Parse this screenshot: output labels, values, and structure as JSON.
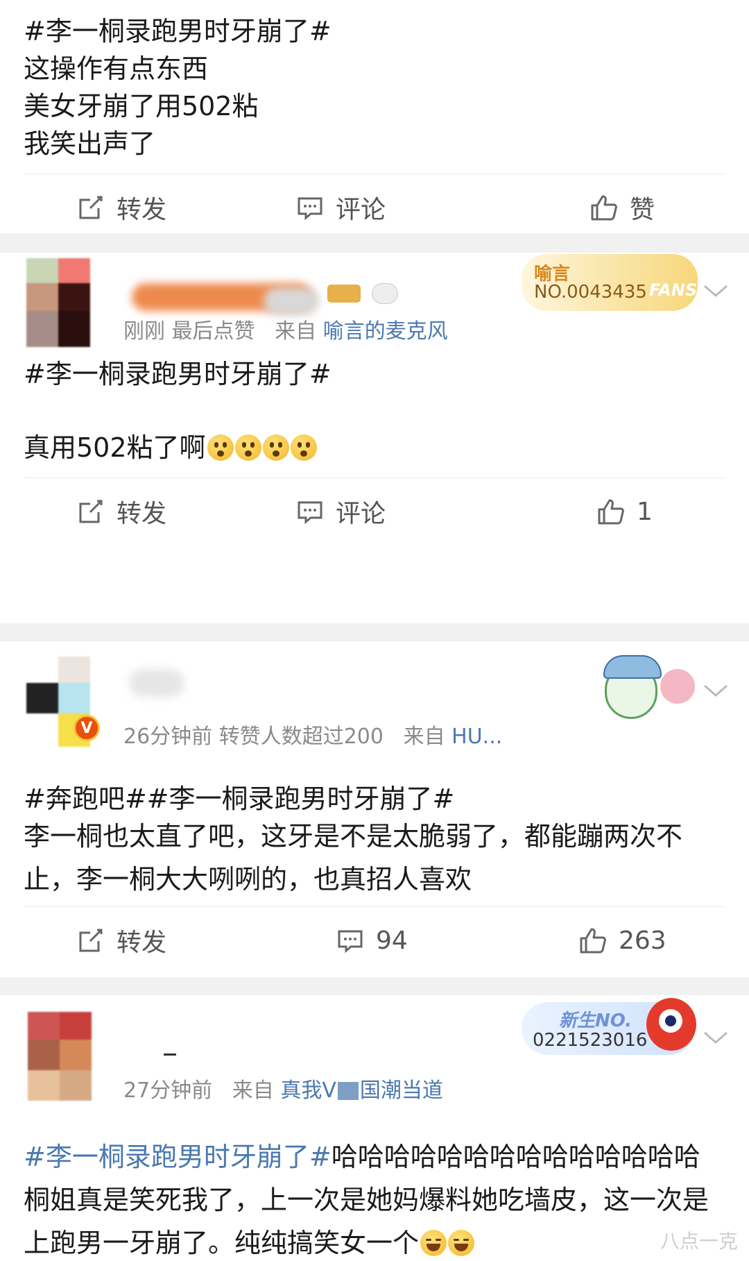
{
  "actions": {
    "repost": "转发",
    "comment": "评论",
    "like": "赞"
  },
  "post1": {
    "hashtag": "#李一桐录跑男时牙崩了#",
    "lines": [
      "这操作有点东西",
      "美女牙崩了用502粘",
      "我笑出声了"
    ]
  },
  "post2": {
    "meta_time": "刚刚 最后点赞",
    "meta_from": "来自",
    "meta_source": "喻言的麦克风",
    "badge_title": "喻言",
    "badge_number": "NO.0043435",
    "badge_fans": "FANS",
    "hashtag": "#李一桐录跑男时牙崩了#",
    "text": "真用502粘了啊",
    "like_count": "1"
  },
  "post3": {
    "meta_time": "26分钟前 转赞人数超过200",
    "meta_from": "来自",
    "meta_source": "HU...",
    "verified": "V",
    "hashtag": "#奔跑吧##李一桐录跑男时牙崩了#",
    "text": "李一桐也太直了吧，这牙是不是太脆弱了，都能蹦两次不止，李一桐大大咧咧的，也真招人喜欢",
    "comment_count": "94",
    "like_count": "263"
  },
  "post4": {
    "meta_time": "27分钟前",
    "meta_from": "来自",
    "meta_source": "真我V",
    "meta_source2": "国潮当道",
    "badge_title": "新生NO.",
    "badge_number": "0221523016",
    "hashtag": "#李一桐录跑男时牙崩了#",
    "text_after_hashtag": "哈哈哈哈哈哈哈哈哈哈哈哈哈哈桐姐真是笑死我了，上一次是她妈爆料她吃墙皮，这一次是上跑男一牙崩了。纯纯搞笑女一个"
  },
  "watermark": "八点一克",
  "colors": {
    "link": "#4a78b0",
    "meta": "#8a8a8a",
    "separator": "#f1f1f1",
    "badge_gold": "#f6d77a"
  }
}
